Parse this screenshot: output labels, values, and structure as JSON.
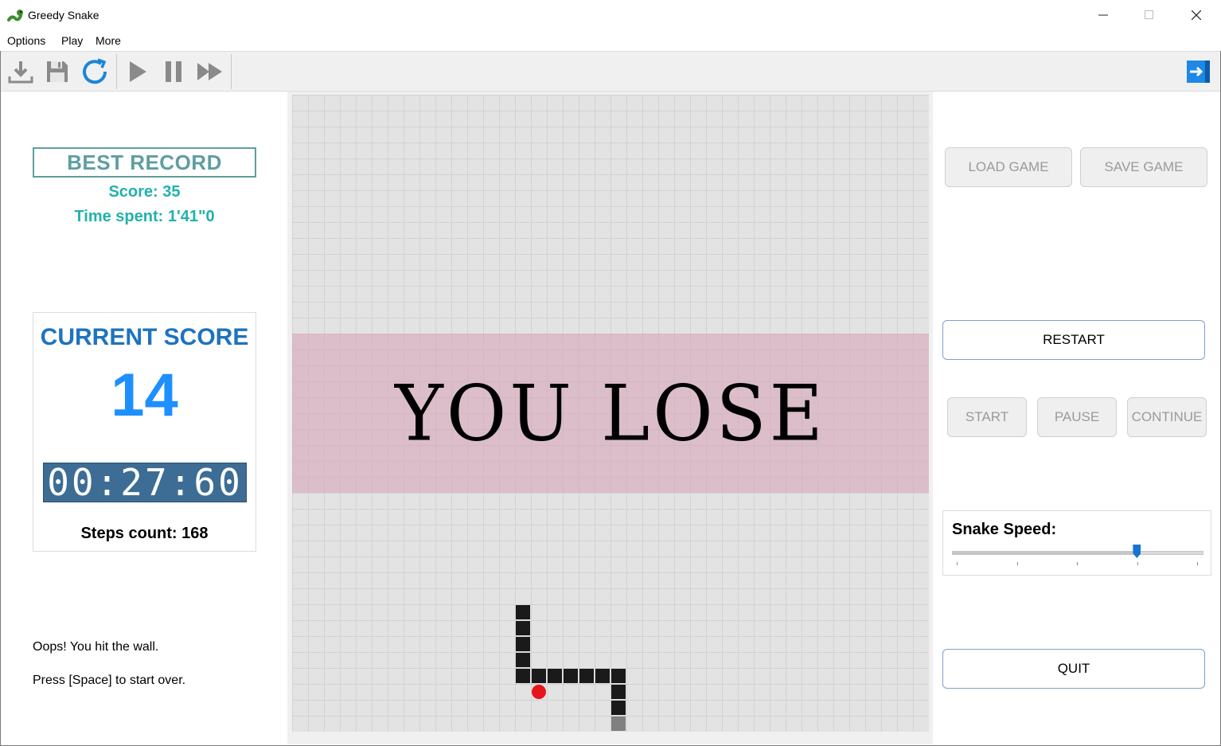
{
  "window": {
    "title": "Greedy Snake"
  },
  "menu": {
    "items": [
      "Options",
      "Play",
      "More"
    ]
  },
  "toolbar": {
    "icons": [
      "download-icon",
      "save-icon",
      "refresh-icon",
      "play-icon",
      "pause-icon",
      "fast-forward-icon",
      "exit-icon"
    ]
  },
  "best_record": {
    "title": "BEST RECORD",
    "score": "Score: 35",
    "time": "Time spent: 1'41\"0"
  },
  "current": {
    "title": "CURRENT SCORE",
    "score": "14",
    "timer": "00:27:60",
    "steps": "Steps count: 168"
  },
  "messages": {
    "line1": "Oops! You hit the wall.",
    "line2": "Press [Space] to start over."
  },
  "board": {
    "overlay_text": "YOU LOSE",
    "grid_cols": 40,
    "grid_rows": 40,
    "snake_cells": [
      [
        14,
        32
      ],
      [
        14,
        33
      ],
      [
        14,
        34
      ],
      [
        14,
        35
      ],
      [
        14,
        36
      ],
      [
        15,
        36
      ],
      [
        16,
        36
      ],
      [
        17,
        36
      ],
      [
        18,
        36
      ],
      [
        19,
        36
      ],
      [
        20,
        36
      ],
      [
        20,
        37
      ],
      [
        20,
        38
      ],
      [
        20,
        39
      ]
    ],
    "snake_tail_cell": [
      20,
      39
    ],
    "food_cell": [
      15,
      37
    ],
    "colors": {
      "snake": "#1a1a1a",
      "tail": "#808080",
      "food": "#e8141c",
      "overlay": "#d6a0b4"
    }
  },
  "buttons": {
    "load_game": "LOAD GAME",
    "save_game": "SAVE GAME",
    "restart": "RESTART",
    "start": "START",
    "pause": "PAUSE",
    "continue": "CONTINUE",
    "quit": "QUIT"
  },
  "speed": {
    "label": "Snake Speed:",
    "level": 0.74,
    "ticks": 5
  }
}
